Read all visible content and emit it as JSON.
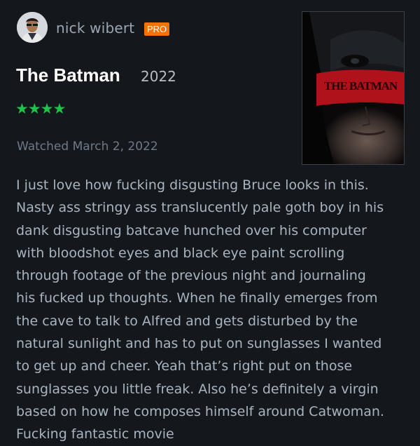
{
  "review": {
    "author": "nick wibert",
    "badge": "PRO",
    "film_title": "The Batman",
    "film_year": "2022",
    "rating_stars": "★★★★",
    "rating": 4,
    "watched": "Watched March 2, 2022",
    "text": "I just love how fucking disgusting Bruce looks in this.\nNasty ass stringy ass translucently pale goth boy in his\ndank disgusting batcave hunched over his computer\nwith bloodshot eyes and black eye paint scrolling\nthrough footage of the previous night and journaling\nhis fucked up thoughts. When he finally emerges from\nthe cave to talk to Alfred and gets disturbed by the\nnatural sunlight and has to put on sunglasses I wanted\nto get up and cheer. Yeah that’s right put on those\nsunglasses you little freak. Also he’s definitely a virgin\nbased on how he composes himself around Catwoman.\nFucking fantastic movie"
  },
  "poster": {
    "logo_text": "THE BATMAN"
  },
  "colors": {
    "background": "#14181d",
    "badge": "#f27405",
    "stars": "#1fc34a",
    "poster_red": "#b0121b"
  },
  "icons": {
    "avatar": "avatar-photo",
    "rating": "star-icon"
  }
}
